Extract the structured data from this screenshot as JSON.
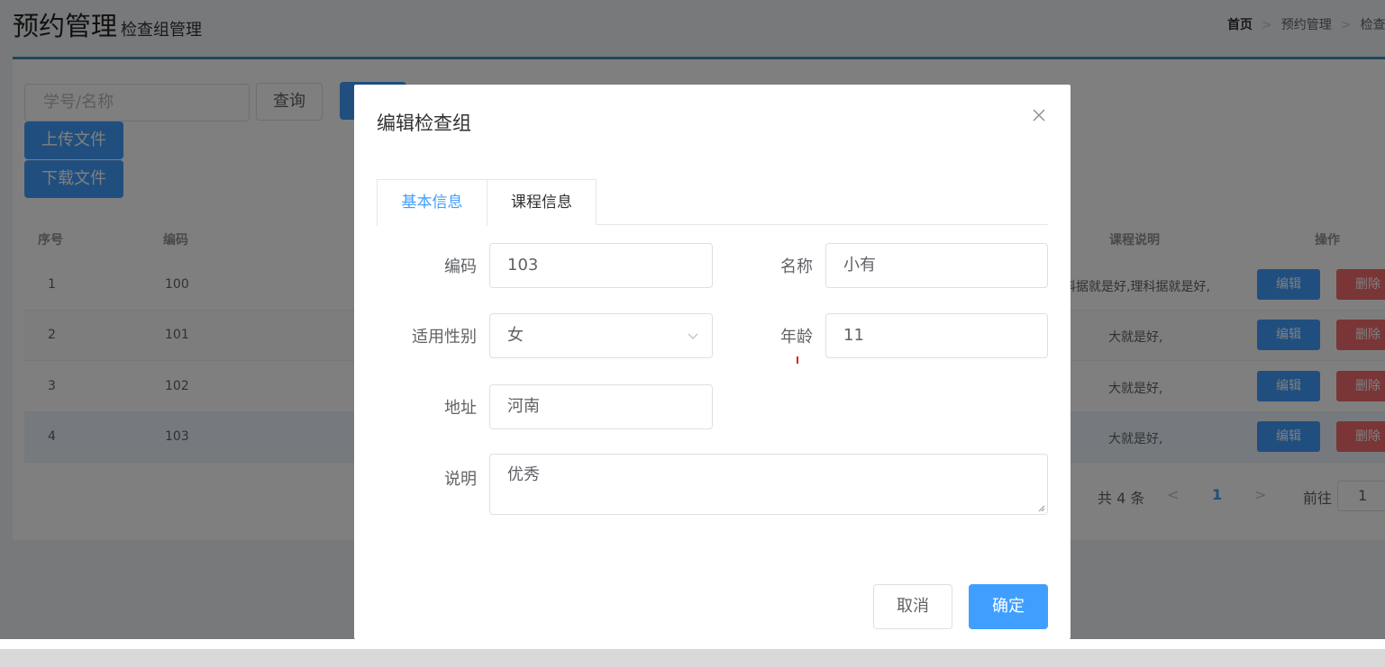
{
  "header": {
    "title": "预约管理",
    "subtitle": "检查组管理"
  },
  "breadcrumb": {
    "home": "首页",
    "item1": "预约管理",
    "item2": "检查"
  },
  "toolbar": {
    "search_placeholder": "学号/名称",
    "query_label": "查询",
    "upload_label": "上传文件",
    "download_label": "下载文件"
  },
  "table": {
    "headers": {
      "index": "序号",
      "code": "编码",
      "course_desc": "课程说明",
      "ops": "操作"
    },
    "rows": [
      {
        "index": "1",
        "code": "100",
        "desc": "科据就是好,理科据就是好,"
      },
      {
        "index": "2",
        "code": "101",
        "desc": "大就是好,"
      },
      {
        "index": "3",
        "code": "102",
        "desc": "大就是好,"
      },
      {
        "index": "4",
        "code": "103",
        "desc": "大就是好,"
      }
    ],
    "edit_label": "编辑",
    "delete_label": "删除"
  },
  "pagination": {
    "total": "共 4 条",
    "current": "1",
    "goto_label": "前往",
    "goto_value": "1"
  },
  "dialog": {
    "title": "编辑检查组",
    "tabs": [
      "基本信息",
      "课程信息"
    ],
    "fields": {
      "code_label": "编码",
      "code_value": "103",
      "name_label": "名称",
      "name_value": "小有",
      "gender_label": "适用性别",
      "gender_value": "女",
      "age_label": "年龄",
      "age_value": "11",
      "address_label": "地址",
      "address_value": "河南",
      "desc_label": "说明",
      "desc_value": "优秀"
    },
    "cancel_label": "取消",
    "ok_label": "确定"
  },
  "colors": {
    "primary": "#409eff",
    "danger": "#f56c6c",
    "box_accent": "#3c8dbc"
  }
}
